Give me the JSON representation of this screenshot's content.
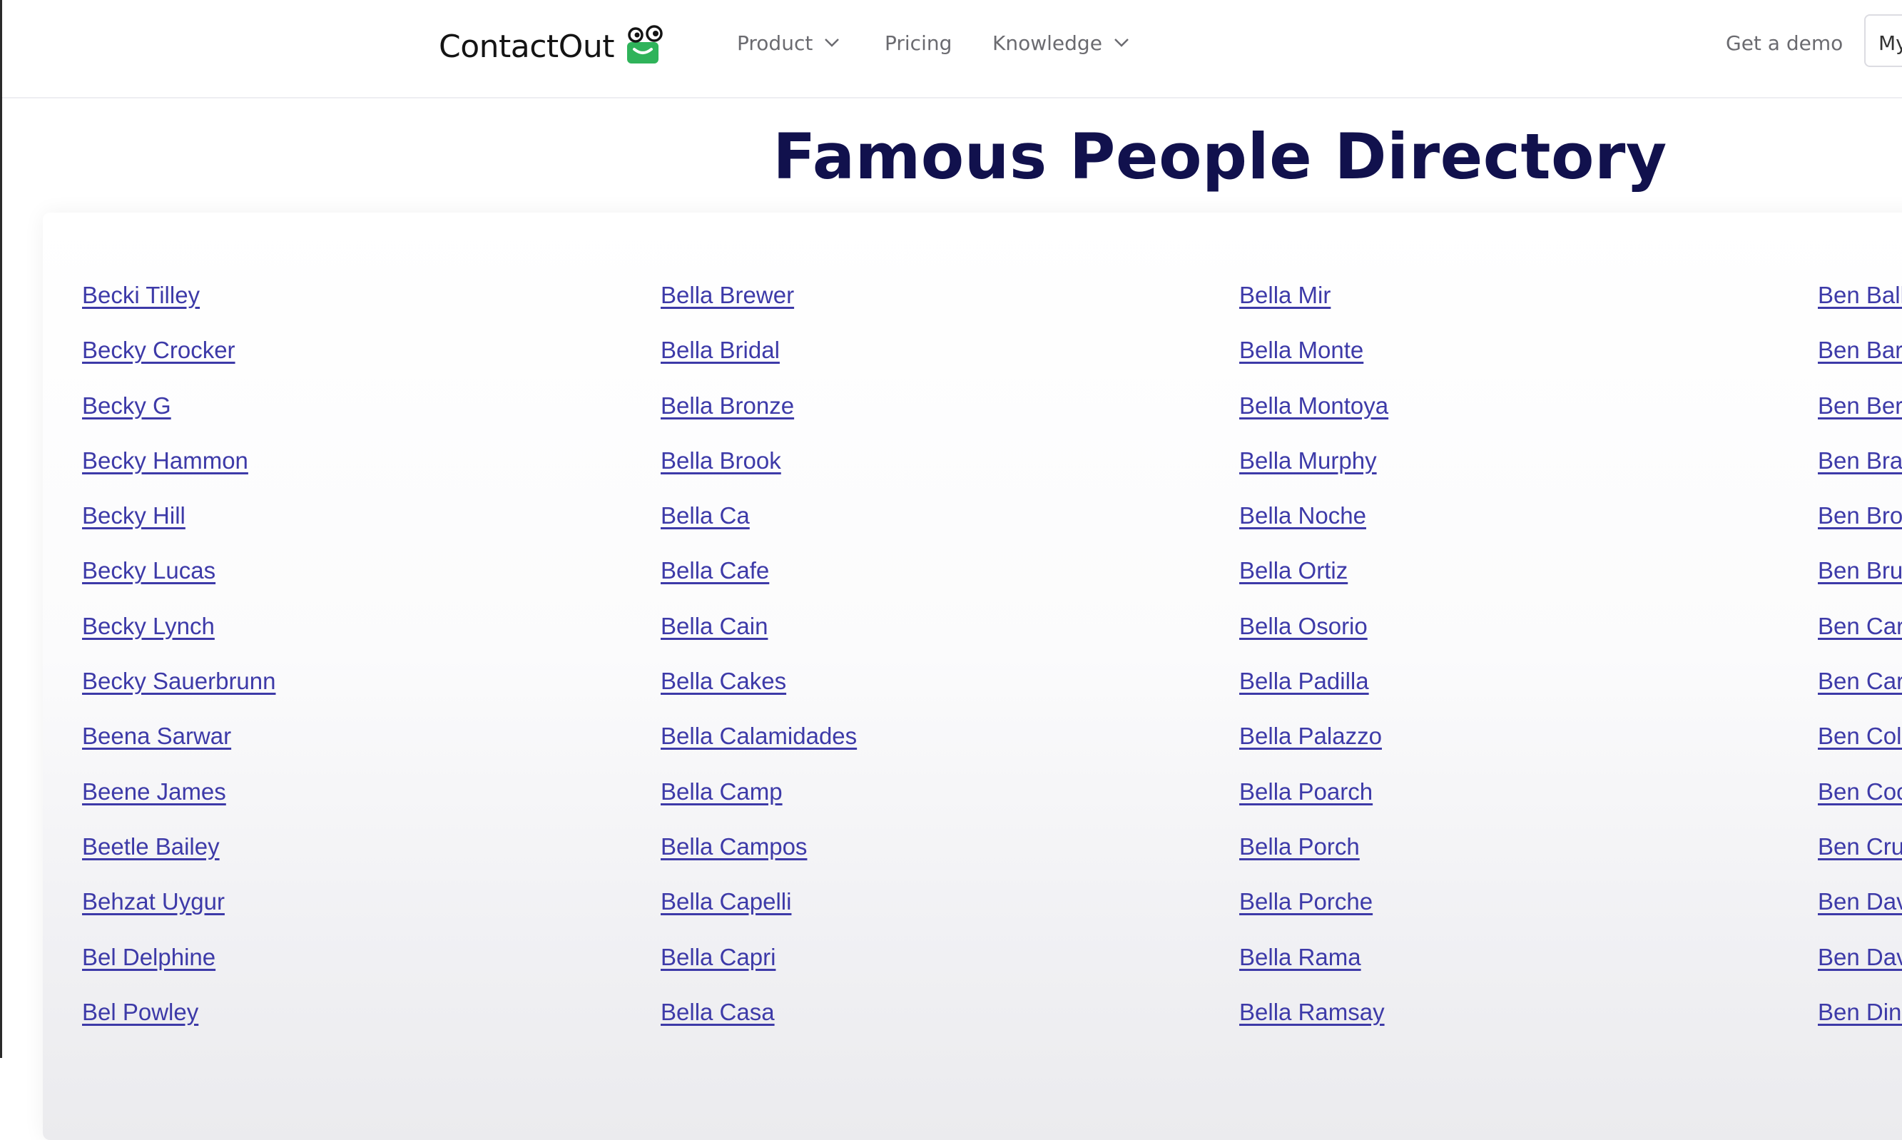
{
  "header": {
    "logo_text": "ContactOut",
    "logo_colors": {
      "green": "#2fb35a",
      "text": "#141414"
    },
    "nav": {
      "product": "Product",
      "pricing": "Pricing",
      "knowledge": "Knowledge"
    },
    "get_demo": "Get a demo",
    "my_account": "My"
  },
  "main": {
    "title": "Famous People Directory",
    "link_color": "#3d3aa8",
    "columns": [
      [
        "Becki Tilley",
        "Becky Crocker",
        "Becky G",
        "Becky Hammon",
        "Becky Hill",
        "Becky Lucas",
        "Becky Lynch",
        "Becky Sauerbrunn",
        "Beena Sarwar",
        "Beene James",
        "Beetle Bailey",
        "Behzat Uygur",
        "Bel Delphine",
        "Bel Powley"
      ],
      [
        "Bella Brewer",
        "Bella Bridal",
        "Bella Bronze",
        "Bella Brook",
        "Bella Ca",
        "Bella Cafe",
        "Bella Cain",
        "Bella Cakes",
        "Bella Calamidades",
        "Bella Camp",
        "Bella Campos",
        "Bella Capelli",
        "Bella Capri",
        "Bella Casa"
      ],
      [
        "Bella Mir",
        "Bella Monte",
        "Bella Montoya",
        "Bella Murphy",
        "Bella Noche",
        "Bella Ortiz",
        "Bella Osorio",
        "Bella Padilla",
        "Bella Palazzo",
        "Bella Poarch",
        "Bella Porch",
        "Bella Porche",
        "Bella Rama",
        "Bella Ramsay"
      ],
      [
        "Ben Balle",
        "Ben Barr",
        "Ben Berr",
        "Ben Brac",
        "Ben Brov",
        "Ben Brur",
        "Ben Carc",
        "Ben Cars",
        "Ben Coll",
        "Ben Coo",
        "Ben Crur",
        "Ben Dav",
        "Ben Dav",
        "Ben Dinu"
      ]
    ]
  }
}
